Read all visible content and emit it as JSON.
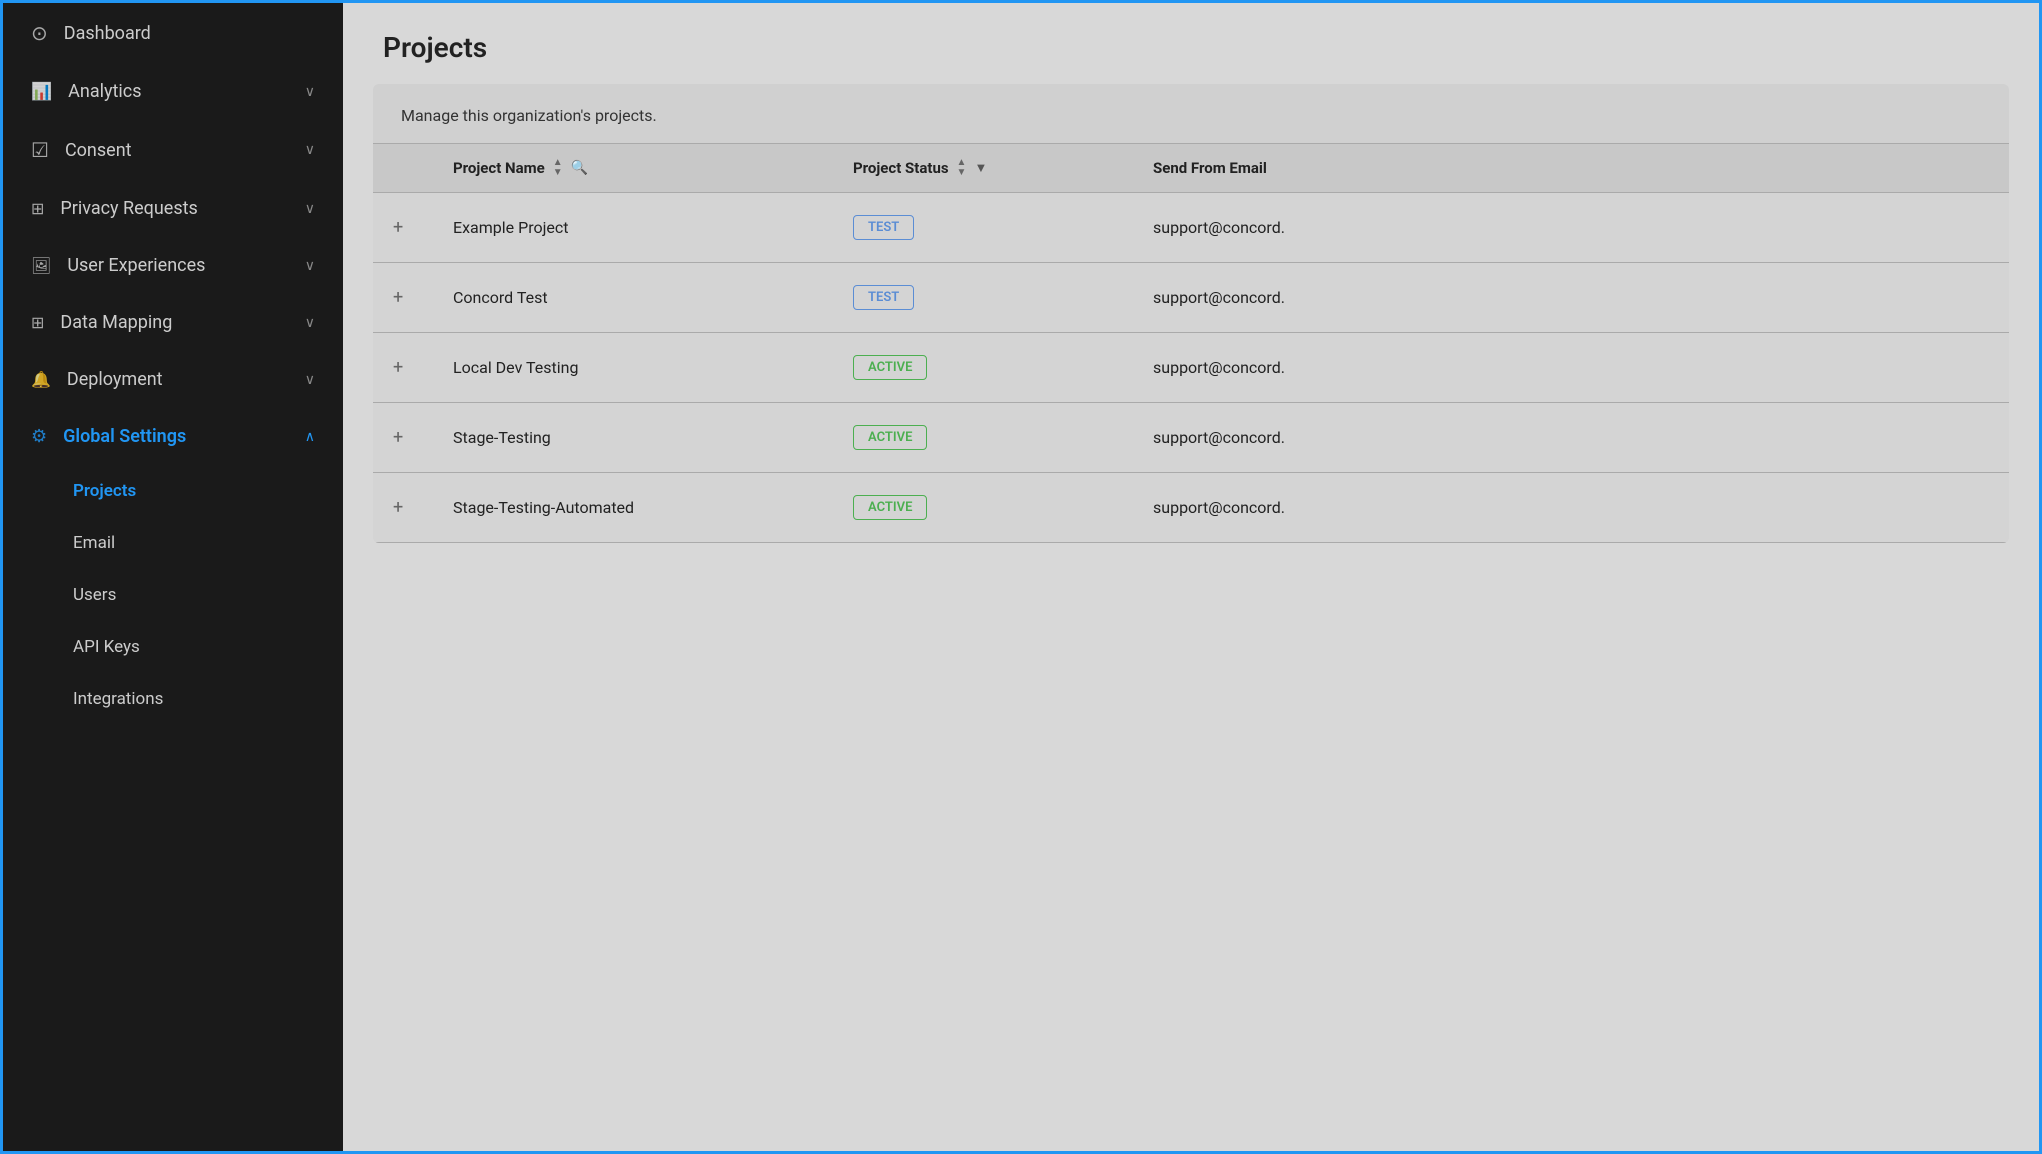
{
  "sidebar": {
    "items": [
      {
        "id": "dashboard",
        "label": "Dashboard",
        "icon": "⊙",
        "hasChevron": false,
        "active": false
      },
      {
        "id": "analytics",
        "label": "Analytics",
        "icon": "⊡",
        "hasChevron": true,
        "active": false
      },
      {
        "id": "consent",
        "label": "Consent",
        "icon": "☑",
        "hasChevron": true,
        "active": false
      },
      {
        "id": "privacy-requests",
        "label": "Privacy Requests",
        "icon": "⊞",
        "hasChevron": true,
        "active": false
      },
      {
        "id": "user-experiences",
        "label": "User Experiences",
        "icon": "⊟",
        "hasChevron": true,
        "active": false
      },
      {
        "id": "data-mapping",
        "label": "Data Mapping",
        "icon": "⊞",
        "hasChevron": true,
        "active": false
      },
      {
        "id": "deployment",
        "label": "Deployment",
        "icon": "🔔",
        "hasChevron": true,
        "active": false
      },
      {
        "id": "global-settings",
        "label": "Global Settings",
        "icon": "⚙",
        "hasChevron": true,
        "active": true,
        "expanded": true
      }
    ],
    "subitems": [
      {
        "id": "projects",
        "label": "Projects",
        "active": true
      },
      {
        "id": "email",
        "label": "Email",
        "active": false
      },
      {
        "id": "users",
        "label": "Users",
        "active": false
      },
      {
        "id": "api-keys",
        "label": "API Keys",
        "active": false
      },
      {
        "id": "integrations",
        "label": "Integrations",
        "active": false
      }
    ]
  },
  "page": {
    "title": "Projects",
    "description": "Manage this organization's projects."
  },
  "table": {
    "columns": [
      {
        "id": "expand",
        "label": "",
        "sortable": false,
        "filterable": false,
        "searchable": false
      },
      {
        "id": "name",
        "label": "Project Name",
        "sortable": true,
        "filterable": false,
        "searchable": true
      },
      {
        "id": "status",
        "label": "Project Status",
        "sortable": true,
        "filterable": true,
        "searchable": false
      },
      {
        "id": "email",
        "label": "Send From Email",
        "sortable": false,
        "filterable": false,
        "searchable": false
      }
    ],
    "rows": [
      {
        "id": 1,
        "name": "Example Project",
        "status": "TEST",
        "statusType": "test",
        "email": "support@concord."
      },
      {
        "id": 2,
        "name": "Concord Test",
        "status": "TEST",
        "statusType": "test",
        "email": "support@concord."
      },
      {
        "id": 3,
        "name": "Local Dev Testing",
        "status": "ACTIVE",
        "statusType": "active",
        "email": "support@concord."
      },
      {
        "id": 4,
        "name": "Stage-Testing",
        "status": "ACTIVE",
        "statusType": "active",
        "email": "support@concord."
      },
      {
        "id": 5,
        "name": "Stage-Testing-Automated",
        "status": "ACTIVE",
        "statusType": "active",
        "email": "support@concord."
      }
    ]
  },
  "icons": {
    "dashboard": "⊙",
    "analytics": "📈",
    "consent": "☑",
    "privacy": "🗂",
    "user-exp": "🖼",
    "data-mapping": "⊞",
    "deployment": "🔔",
    "settings": "⚙",
    "chevron-down": "∨",
    "chevron-up": "∧",
    "plus": "+",
    "sort-up": "▲",
    "sort-down": "▼",
    "search": "🔍",
    "filter": "▼"
  }
}
